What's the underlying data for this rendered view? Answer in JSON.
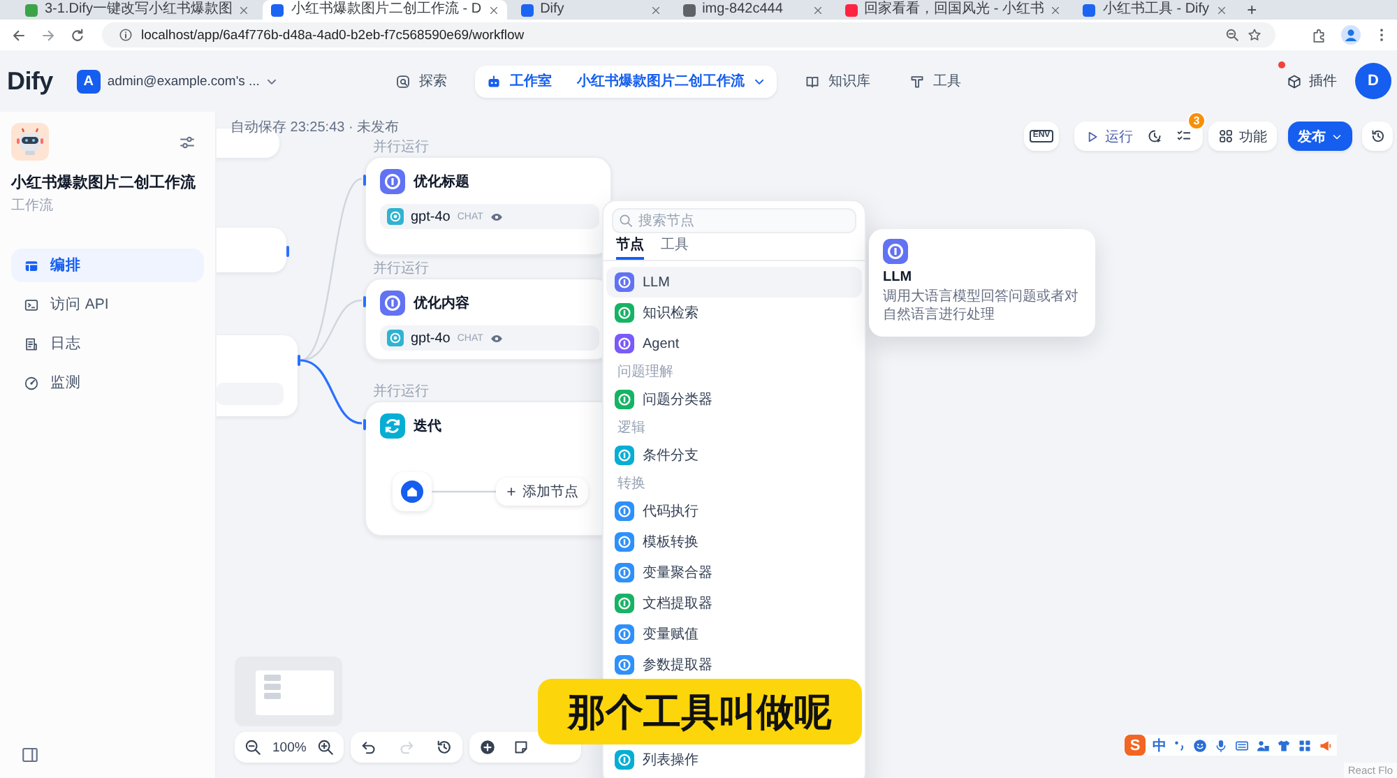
{
  "browser": {
    "tabs": [
      {
        "title": "3-1.Dify一键改写小红书爆款图",
        "selected": false,
        "color": "#3ca34a"
      },
      {
        "title": "小红书爆款图片二创工作流 - D",
        "selected": true,
        "color": "#1c64f2"
      },
      {
        "title": "Dify",
        "selected": false,
        "color": "#1c64f2"
      },
      {
        "title": "img-842c444",
        "selected": false,
        "color": "#5f6368"
      },
      {
        "title": "回家看看，回国风光 - 小红书",
        "selected": false,
        "color": "#ff2442"
      },
      {
        "title": "小红书工具 - Dify",
        "selected": false,
        "color": "#1c64f2"
      }
    ],
    "new_tab": "+",
    "url": "localhost/app/6a4f776b-d48a-4ad0-b2eb-f7c568590e69/workflow"
  },
  "header": {
    "logo": "Dify",
    "workspace": {
      "initial": "A",
      "name": "admin@example.com's ..."
    },
    "nav": [
      {
        "label": "探索",
        "selected": false
      },
      {
        "label": "工作室",
        "selected": true,
        "current_app": "小红书爆款图片二创工作流"
      },
      {
        "label": "知识库",
        "selected": false
      },
      {
        "label": "工具",
        "selected": false
      }
    ],
    "plugins": {
      "label": "插件",
      "has_update": true
    },
    "avatar": "D"
  },
  "sidebar": {
    "app_name": "小红书爆款图片二创工作流",
    "app_type": "工作流",
    "items": [
      {
        "label": "编排",
        "selected": true
      },
      {
        "label": "访问 API",
        "selected": false
      },
      {
        "label": "日志",
        "selected": false
      },
      {
        "label": "监测",
        "selected": false
      }
    ]
  },
  "canvas": {
    "autosave": "自动保存 23:25:43 · 未发布",
    "toolbar": {
      "env": "ENV",
      "run": "运行",
      "issues": "3",
      "features": "功能",
      "publish": "发布"
    },
    "nodes": [
      {
        "kind": "llm",
        "badge": "并行运行",
        "title": "优化标题",
        "model": "gpt-4o",
        "mode": "CHAT",
        "edge_active": false
      },
      {
        "kind": "llm",
        "badge": "并行运行",
        "title": "优化内容",
        "model": "gpt-4o",
        "mode": "CHAT",
        "edge_active": false
      },
      {
        "kind": "iteration",
        "badge": "并行运行",
        "title": "迭代",
        "add_node": "添加节点",
        "edge_active": true
      }
    ],
    "zoom": "100%",
    "history": {
      "undo_disabled": false,
      "redo_disabled": true
    },
    "attribution": "React Flo"
  },
  "node_picker": {
    "search": {
      "placeholder": "搜索节点"
    },
    "tabs": [
      {
        "label": "节点",
        "selected": true
      },
      {
        "label": "工具",
        "selected": false
      }
    ],
    "entries": [
      {
        "kind": "node",
        "label": "LLM",
        "color": "#6172f3",
        "highlighted": true
      },
      {
        "kind": "node",
        "label": "知识检索",
        "color": "#16b364",
        "highlighted": false
      },
      {
        "kind": "node",
        "label": "Agent",
        "color": "#7a5af8",
        "highlighted": false
      },
      {
        "kind": "heading",
        "label": "问题理解"
      },
      {
        "kind": "node",
        "label": "问题分类器",
        "color": "#16b364",
        "highlighted": false
      },
      {
        "kind": "heading",
        "label": "逻辑"
      },
      {
        "kind": "node",
        "label": "条件分支",
        "color": "#06aed4",
        "highlighted": false
      },
      {
        "kind": "heading",
        "label": "转换"
      },
      {
        "kind": "node",
        "label": "代码执行",
        "color": "#2e90fa",
        "highlighted": false
      },
      {
        "kind": "node",
        "label": "模板转换",
        "color": "#2e90fa",
        "highlighted": false
      },
      {
        "kind": "node",
        "label": "变量聚合器",
        "color": "#2e90fa",
        "highlighted": false
      },
      {
        "kind": "node",
        "label": "文档提取器",
        "color": "#16b364",
        "highlighted": false
      },
      {
        "kind": "node",
        "label": "变量赋值",
        "color": "#2e90fa",
        "highlighted": false
      },
      {
        "kind": "node",
        "label": "参数提取器",
        "color": "#2e90fa",
        "highlighted": false
      },
      {
        "kind": "covered"
      },
      {
        "kind": "covered"
      },
      {
        "kind": "node",
        "label": "列表操作",
        "color": "#06aed4",
        "highlighted": false
      }
    ]
  },
  "tooltip": {
    "title": "LLM",
    "description": "调用大语言模型回答问题或者对自然语言进行处理"
  },
  "subtitle": "那个工具叫做呢",
  "ime": {
    "logo": "S",
    "mode": "中"
  }
}
